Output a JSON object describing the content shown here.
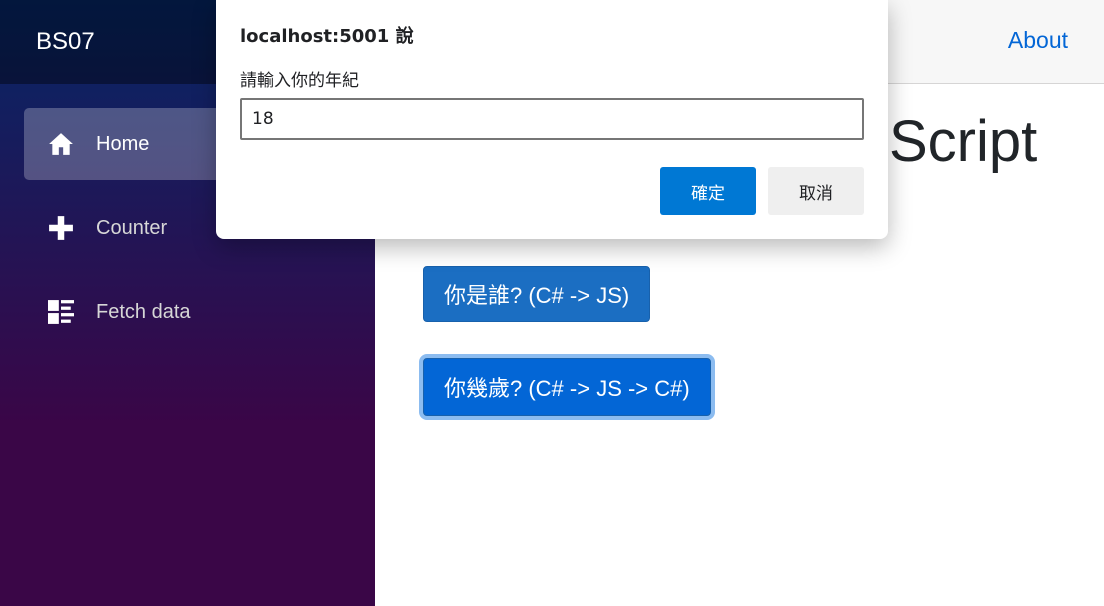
{
  "sidebar": {
    "brand": "BS07",
    "items": [
      {
        "label": "Home",
        "icon": "home-icon",
        "active": true
      },
      {
        "label": "Counter",
        "icon": "plus-icon",
        "active": false
      },
      {
        "label": "Fetch data",
        "icon": "list-rich-icon",
        "active": false
      }
    ]
  },
  "header": {
    "about_label": "About"
  },
  "main": {
    "heading": "Script",
    "subtext": "",
    "who_button": "你是誰? (C# -> JS)",
    "age_button": "你幾歲? (C# -> JS -> C#)"
  },
  "dialog": {
    "title": "localhost:5001 說",
    "message": "請輸入你的年紀",
    "input_value": "18",
    "ok_label": "確定",
    "cancel_label": "取消"
  },
  "colors": {
    "accent": "#0366d6",
    "button": "#1b6ec2",
    "dialog_ok": "#0078d4",
    "sidebar_top": "#052767",
    "sidebar_bottom": "#3a0647"
  }
}
